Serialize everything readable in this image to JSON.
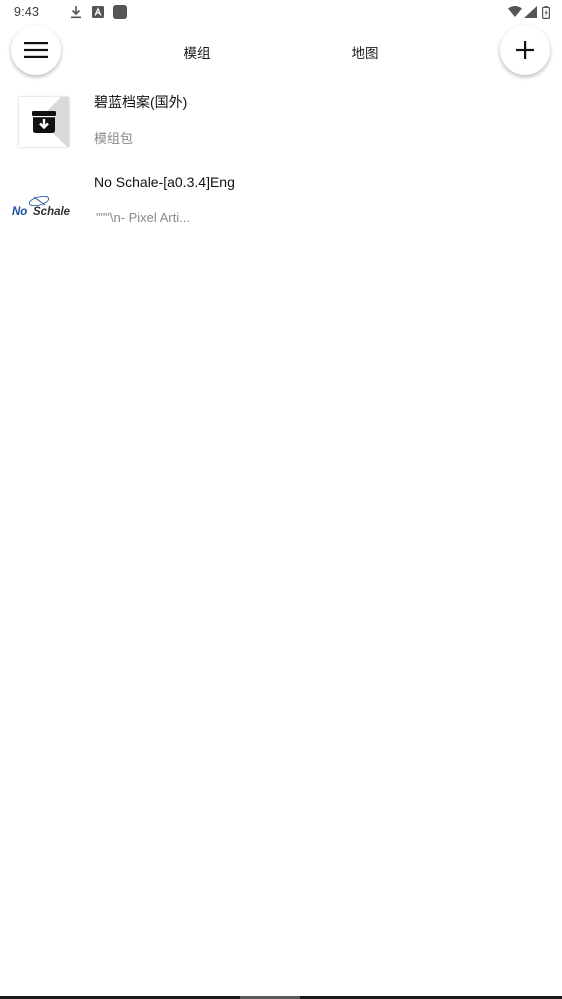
{
  "status_bar": {
    "time": "9:43",
    "left_icons": [
      "download-icon",
      "font-a-icon",
      "app-square-icon"
    ],
    "right_icons": [
      "wifi-icon",
      "cell-signal-icon",
      "battery-icon"
    ]
  },
  "top_bar": {
    "menu_icon": "hamburger-menu-icon",
    "add_icon": "plus-icon",
    "tabs": [
      {
        "label": "模组"
      },
      {
        "label": "地图"
      }
    ]
  },
  "list": {
    "items": [
      {
        "title": "碧蓝档案(国外)",
        "subtitle": "模组包",
        "thumbnail_icon": "archive-download-icon"
      },
      {
        "title": "No Schale-[a0.3.4]Eng",
        "subtitle": "\"\"\"\\n- Pixel Arti...",
        "thumbnail_logo_text": "No Schale"
      }
    ]
  },
  "colors": {
    "text_primary": "#111111",
    "text_secondary": "#8a8a8a",
    "logo_blue": "#1c4fa0",
    "background": "#ffffff"
  }
}
